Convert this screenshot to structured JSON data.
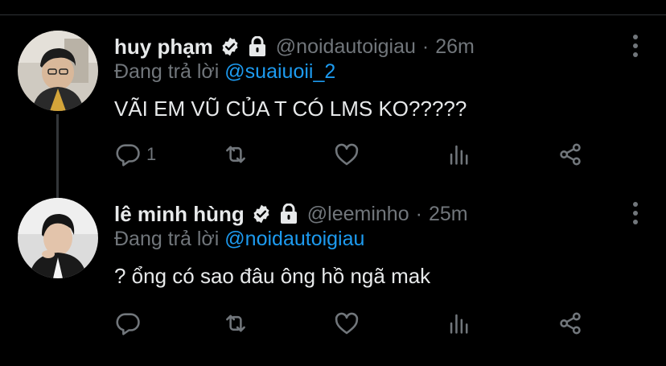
{
  "tweets": [
    {
      "name": "huy phạm",
      "handle": "@noidautoigiau",
      "separator": "·",
      "time": "26m",
      "reply_prefix": "Đang trả lời",
      "reply_to": "@suaiuoii_2",
      "text": "VÃI EM VŨ CỦA T CÓ LMS KO?????",
      "reply_count": "1",
      "icons": [
        "verified-badge-icon",
        "lock-icon",
        "more-vertical-icon",
        "reply-icon",
        "retweet-icon",
        "like-icon",
        "analytics-icon",
        "share-icon"
      ]
    },
    {
      "name": "lê minh hùng",
      "handle": "@leeminho",
      "separator": "·",
      "time": "25m",
      "reply_prefix": "Đang trả lời",
      "reply_to": "@noidautoigiau",
      "text": "? ổng có sao đâu ông hồ ngã mak",
      "reply_count": "",
      "icons": [
        "verified-badge-icon",
        "lock-icon",
        "more-vertical-icon",
        "reply-icon",
        "retweet-icon",
        "like-icon",
        "analytics-icon",
        "share-icon"
      ]
    }
  ],
  "colors": {
    "background": "#000000",
    "primary_text": "#e7e9ea",
    "secondary_text": "#71767b",
    "link": "#1d9bf0",
    "thread_line": "#333639"
  }
}
